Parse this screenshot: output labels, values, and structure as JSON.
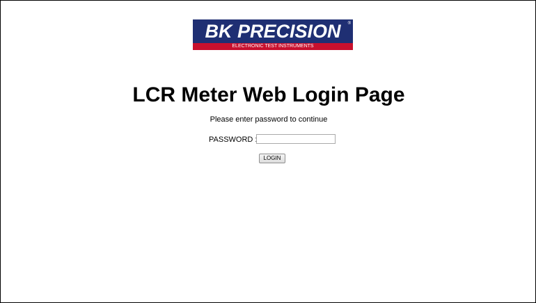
{
  "logo": {
    "brand": "BK PRECISION",
    "registered": "®",
    "tagline": "ELECTRONIC TEST INSTRUMENTS",
    "colors": {
      "brand_blue": "#1f2f73",
      "brand_red": "#c8102e"
    }
  },
  "page": {
    "title": "LCR Meter Web Login Page",
    "subtitle": "Please enter password to continue"
  },
  "form": {
    "password_label": "PASSWORD :",
    "password_value": "",
    "password_placeholder": "",
    "login_label": "LOGIN"
  }
}
